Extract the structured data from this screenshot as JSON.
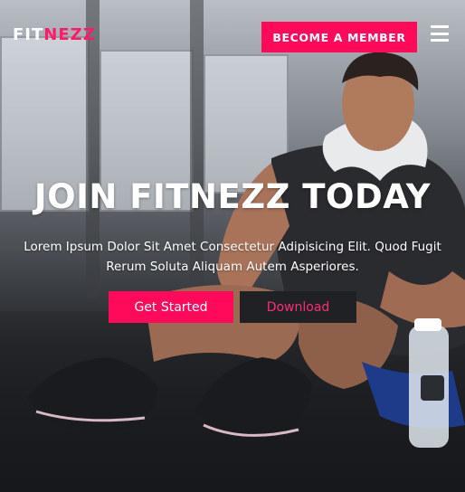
{
  "brand": {
    "logo_part1": "FIT",
    "logo_part2": "NEZZ"
  },
  "nav": {
    "cta_label": "BECOME A MEMBER",
    "menu_icon": "hamburger-menu-icon"
  },
  "hero": {
    "title": "JOIN FITNEZZ TODAY",
    "subtitle": "Lorem Ipsum Dolor Sit Amet Consectetur Adipisicing Elit. Quod Fugit Rerum Soluta Aliquam Autem Asperiores.",
    "primary_button": "Get Started",
    "secondary_button": "Download"
  },
  "colors": {
    "accent": "#ff0a5a",
    "dark": "#1f2124",
    "text": "#ffffff"
  }
}
